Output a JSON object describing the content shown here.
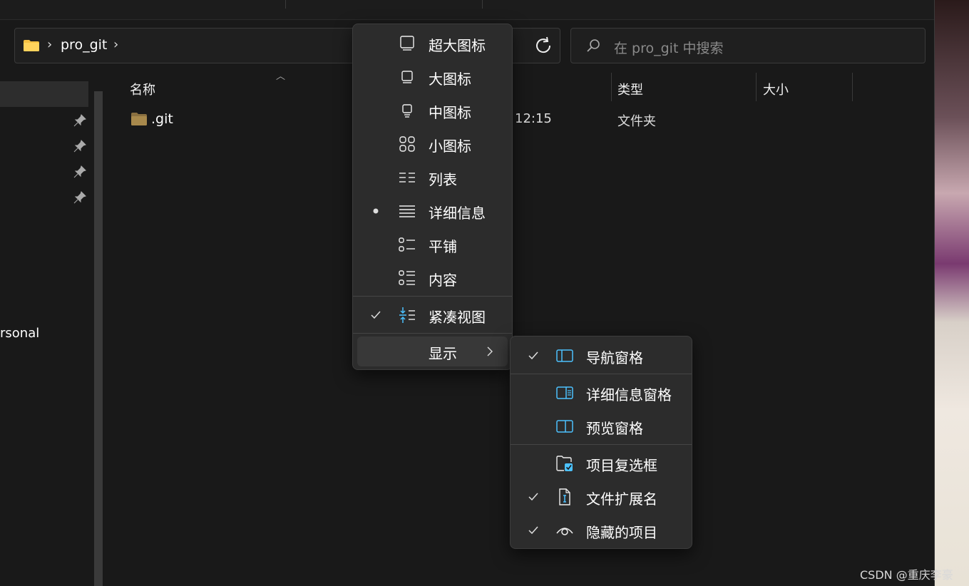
{
  "address_bar": {
    "breadcrumb": "pro_git",
    "separator": "›"
  },
  "search": {
    "placeholder": "在 pro_git 中搜索"
  },
  "nav_pane": {
    "partial_label": "rsonal"
  },
  "columns": {
    "name": "名称",
    "type": "类型",
    "size": "大小"
  },
  "files": [
    {
      "name": ".git",
      "modified": "12:15",
      "type": "文件夹"
    }
  ],
  "view_menu": {
    "items": [
      {
        "label": "超大图标",
        "icon": "extra-large-icons-icon",
        "marked": "none"
      },
      {
        "label": "大图标",
        "icon": "large-icons-icon",
        "marked": "none"
      },
      {
        "label": "中图标",
        "icon": "medium-icons-icon",
        "marked": "none"
      },
      {
        "label": "小图标",
        "icon": "small-icons-icon",
        "marked": "none"
      },
      {
        "label": "列表",
        "icon": "list-icon",
        "marked": "none"
      },
      {
        "label": "详细信息",
        "icon": "details-icon",
        "marked": "bullet"
      },
      {
        "label": "平铺",
        "icon": "tiles-icon",
        "marked": "none"
      },
      {
        "label": "内容",
        "icon": "content-icon",
        "marked": "none"
      },
      {
        "label": "紧凑视图",
        "icon": "compact-view-icon",
        "marked": "check"
      },
      {
        "label": "显示",
        "icon": "",
        "marked": "submenu"
      }
    ]
  },
  "show_menu": {
    "items": [
      {
        "label": "导航窗格",
        "icon": "navigation-pane-icon",
        "checked": true
      },
      {
        "label": "详细信息窗格",
        "icon": "details-pane-icon",
        "checked": false
      },
      {
        "label": "预览窗格",
        "icon": "preview-pane-icon",
        "checked": false
      },
      {
        "label": "项目复选框",
        "icon": "item-checkbox-icon",
        "checked": false
      },
      {
        "label": "文件扩展名",
        "icon": "file-extension-icon",
        "checked": true
      },
      {
        "label": "隐藏的项目",
        "icon": "hidden-items-icon",
        "checked": true
      }
    ]
  },
  "watermark": "CSDN @重庆李豪",
  "colors": {
    "background": "#191919",
    "menu": "#2c2c2c",
    "accent": "#4cc2ff",
    "folder": "#f5c042"
  }
}
